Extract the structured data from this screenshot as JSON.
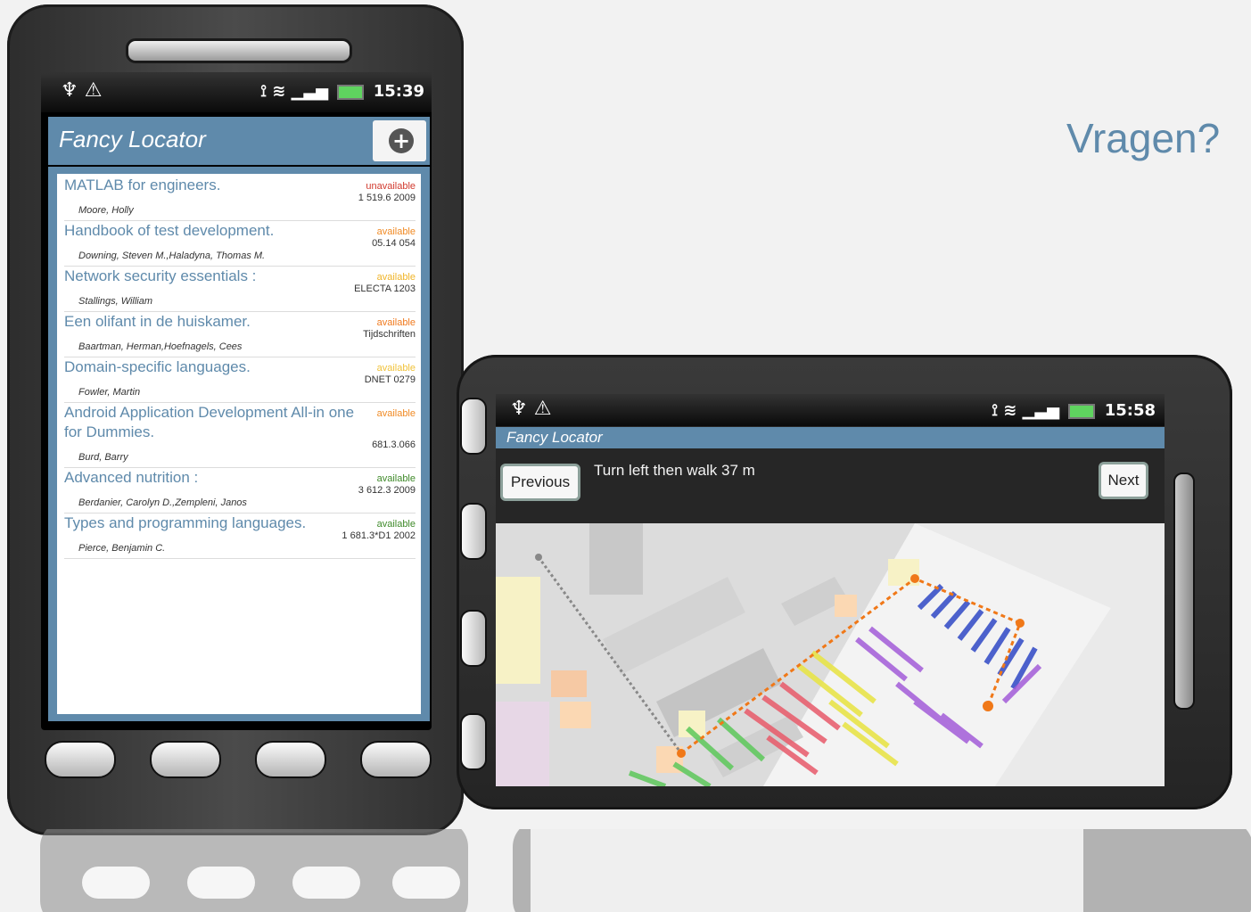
{
  "slide": {
    "title": "Vragen?"
  },
  "portrait": {
    "status_time": "15:39",
    "app_title": "Fancy Locator",
    "items": [
      {
        "title": "MATLAB for engineers.",
        "author": "Moore, Holly",
        "status": "unavailable",
        "code": "1 519.6 2009"
      },
      {
        "title": "Handbook of test development.",
        "author": "Downing, Steven M.,Haladyna, Thomas M.",
        "status": "available",
        "code": "05.14 054"
      },
      {
        "title": "Network security essentials :",
        "author": "Stallings, William",
        "status": "available",
        "code": "ELECTA 1203"
      },
      {
        "title": "Een olifant in de huiskamer.",
        "author": "Baartman, Herman,Hoefnagels, Cees",
        "status": "available",
        "code": "Tijdschriften"
      },
      {
        "title": "Domain-specific languages.",
        "author": "Fowler, Martin",
        "status": "available",
        "code": "DNET 0279"
      },
      {
        "title": "Android Application Development All-in one for Dummies.",
        "author": "Burd, Barry",
        "status": "available",
        "code": "681.3.066"
      },
      {
        "title": "Advanced nutrition :",
        "author": "Berdanier, Carolyn D.,Zempleni, Janos",
        "status": "available",
        "code": "3 612.3 2009"
      },
      {
        "title": "Types and programming languages.",
        "author": "Pierce, Benjamin C.",
        "status": "available",
        "code": "1 681.3*D1 2002"
      }
    ],
    "status_colors": [
      "#d13a2e",
      "#f08a24",
      "#f0b428",
      "#f07a1e",
      "#f0c23a",
      "#f08a24",
      "#3f8a2a",
      "#3f8a2a"
    ]
  },
  "landscape": {
    "status_time": "15:58",
    "app_title": "Fancy Locator",
    "previous_label": "Previous",
    "next_label": "Next",
    "instruction": "Turn left then walk 37 m"
  },
  "icons": [
    "usb-icon",
    "warning-icon",
    "gps-icon",
    "wifi-icon",
    "signal-icon",
    "battery-icon",
    "add-icon"
  ]
}
